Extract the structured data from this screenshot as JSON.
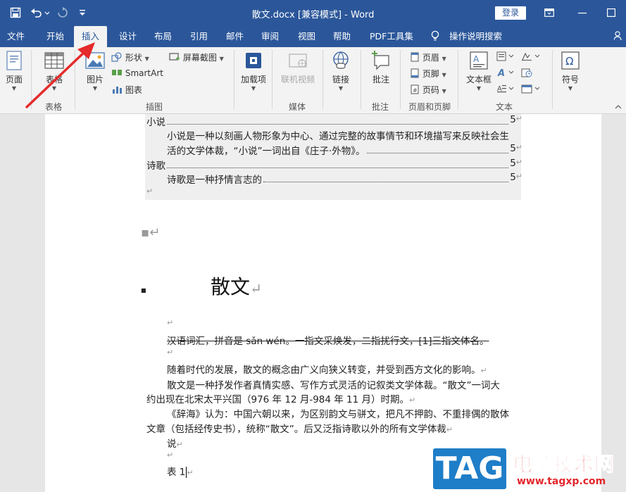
{
  "titlebar": {
    "title": "散文.docx [兼容模式]  -  Word",
    "login": "登录",
    "icons": [
      "save-icon",
      "undo-icon",
      "redo-icon",
      "customize-qat-icon",
      "ribbon-display-icon",
      "minimize-icon",
      "maximize-icon"
    ],
    "color": "#2b579a"
  },
  "tabs": {
    "file": "文件",
    "home": "开始",
    "insert": "插入",
    "design": "设计",
    "layout": "布局",
    "references": "引用",
    "mailings": "邮件",
    "review": "审阅",
    "view": "视图",
    "help": "帮助",
    "pdf": "PDF工具集",
    "tellme": "操作说明搜索"
  },
  "ribbon": {
    "pages": {
      "label": "页面"
    },
    "tables": {
      "label": "表格",
      "group": "表格"
    },
    "illustrations": {
      "pictures": "图片",
      "shapes": "形状",
      "smartart": "SmartArt",
      "chart": "图表",
      "screenshot": "屏幕截图",
      "group": "插图"
    },
    "addins": {
      "label": "加载项"
    },
    "media": {
      "online_video": "联机视频",
      "group": "媒体"
    },
    "links": {
      "label": "链接"
    },
    "comments": {
      "comment": "批注",
      "group": "批注"
    },
    "header_footer": {
      "header": "页眉",
      "footer": "页脚",
      "page_number": "页码",
      "group": "页眉和页脚"
    },
    "text": {
      "textbox": "文本框",
      "group": "文本"
    },
    "symbols": {
      "symbol": "符号"
    }
  },
  "document": {
    "toc": [
      {
        "text": "小说",
        "page": "5"
      },
      {
        "text": "小说是一种以刻画人物形象为中心、通过完整的故事情节和环境描写来反映社会生",
        "page": ""
      },
      {
        "text": "活的文学体裁，“小说”一词出自《庄子·外物》。",
        "page": "5"
      },
      {
        "text": "诗歌",
        "page": "5"
      },
      {
        "text": "诗歌是一种抒情言志的",
        "page": "5"
      }
    ],
    "heading": "散文",
    "strike_line": "汉语词汇，拼音是 sǎn wén。一指文采焕发，二指扰行文，[1]三指文体名。",
    "para1": "随着时代的发展，散文的概念由广义向狭义转变，并受到西方文化的影响。",
    "para2_a": "散文是一种抒发作者真情实感、写作方式灵活的记叙类文学体裁。“散文”一词大",
    "para2_b": "约出现在北宋太平兴国（976 年 12 月-984 年 11 月）时期。",
    "para3_a": "《辞海》认为：中国六朝以来，为区别韵文与骈文，把凡不押韵、不重排偶的散体",
    "para3_b": "文章（包括经传史书），统称“散文”。后又泛指诗歌以外的所有文学体裁",
    "line_shuo": "说",
    "table_caption": "表  1"
  },
  "watermark": {
    "tag": "TAG",
    "name": "电脑技术网",
    "url": "www.tagxp.com"
  }
}
